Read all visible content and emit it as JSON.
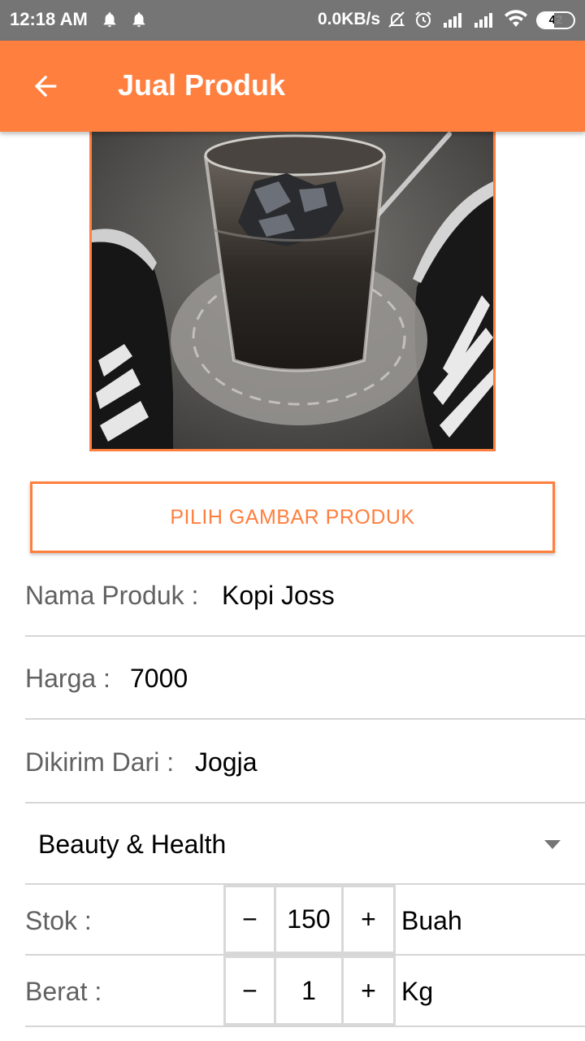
{
  "status_bar": {
    "time": "12:18 AM",
    "net_speed": "0.0KB/s",
    "battery": "42",
    "icons": [
      "notification-bell-icon",
      "notification-bell-icon",
      "muted-icon",
      "alarm-icon",
      "signal-icon",
      "signal-icon",
      "wifi-icon",
      "battery-icon"
    ]
  },
  "app_bar": {
    "title": "Jual Produk",
    "back_icon": "arrow-back-icon"
  },
  "colors": {
    "accent": "#FF7F3E",
    "status_bar": "#757575",
    "label_text": "#616161",
    "divider": "#d6d6d6"
  },
  "pick_image_button": "PILIH GAMBAR PRODUK",
  "form": {
    "name_label": "Nama Produk :",
    "name_value": "Kopi Joss",
    "price_label": "Harga :",
    "price_value": "7000",
    "origin_label": "Dikirim Dari :",
    "origin_value": "Jogja",
    "category_selected": "Beauty & Health",
    "stock_label": "Stok :",
    "stock_value": "150",
    "stock_unit": "Buah",
    "weight_label": "Berat  :",
    "weight_value": "1",
    "weight_unit": "Kg",
    "minus": "−",
    "plus": "+"
  }
}
